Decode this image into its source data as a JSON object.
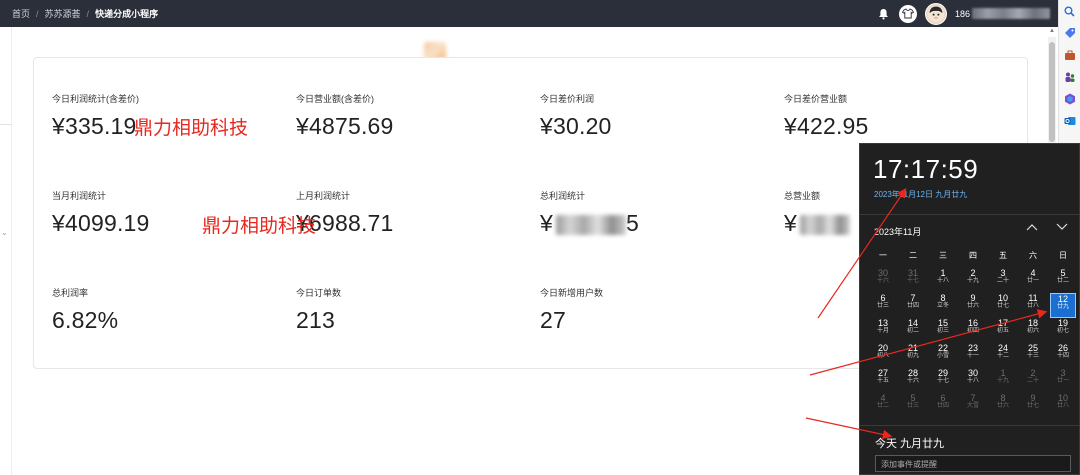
{
  "breadcrumb": [
    "首页",
    "苏苏源荟",
    "快递分成小程序"
  ],
  "breadcrumb_sep": "/",
  "header": {
    "phone_prefix": "186",
    "icons": [
      "bell-icon",
      "shirt-icon",
      "avatar"
    ]
  },
  "stats": [
    {
      "label": "今日利润统计(含差价)",
      "value": "¥335.19"
    },
    {
      "label": "今日营业额(含差价)",
      "value": "¥4875.69"
    },
    {
      "label": "今日差价利润",
      "value": "¥30.20"
    },
    {
      "label": "今日差价营业额",
      "value": "¥422.95"
    },
    {
      "label": "当月利润统计",
      "value": "¥4099.19"
    },
    {
      "label": "上月利润统计",
      "value": "¥6988.71"
    },
    {
      "label": "总利润统计",
      "value": "¥",
      "value_tail": "5"
    },
    {
      "label": "总营业额",
      "value": "¥"
    },
    {
      "label": "总利润率",
      "value": "6.82%"
    },
    {
      "label": "今日订单数",
      "value": "213"
    },
    {
      "label": "今日新增用户数",
      "value": "27"
    }
  ],
  "watermarks": [
    "鼎力相助科技",
    "鼎力相助科技"
  ],
  "calendar": {
    "time": "17:17:59",
    "date_long": "2023年11月12日 九月廿九",
    "month_label": "2023年11月",
    "weekdays": [
      "一",
      "二",
      "三",
      "四",
      "五",
      "六",
      "日"
    ],
    "days": [
      {
        "d": "30",
        "l": "十六",
        "dim": true
      },
      {
        "d": "31",
        "l": "十七",
        "dim": true
      },
      {
        "d": "1",
        "l": "十八"
      },
      {
        "d": "2",
        "l": "十九"
      },
      {
        "d": "3",
        "l": "二十"
      },
      {
        "d": "4",
        "l": "廿一"
      },
      {
        "d": "5",
        "l": "廿二"
      },
      {
        "d": "6",
        "l": "廿三"
      },
      {
        "d": "7",
        "l": "廿四"
      },
      {
        "d": "8",
        "l": "立冬"
      },
      {
        "d": "9",
        "l": "廿六"
      },
      {
        "d": "10",
        "l": "廿七"
      },
      {
        "d": "11",
        "l": "廿八"
      },
      {
        "d": "12",
        "l": "廿九",
        "today": true
      },
      {
        "d": "13",
        "l": "十月"
      },
      {
        "d": "14",
        "l": "初二"
      },
      {
        "d": "15",
        "l": "初三"
      },
      {
        "d": "16",
        "l": "初四"
      },
      {
        "d": "17",
        "l": "初五"
      },
      {
        "d": "18",
        "l": "初六"
      },
      {
        "d": "19",
        "l": "初七"
      },
      {
        "d": "20",
        "l": "初八"
      },
      {
        "d": "21",
        "l": "初九"
      },
      {
        "d": "22",
        "l": "小雪"
      },
      {
        "d": "23",
        "l": "十一"
      },
      {
        "d": "24",
        "l": "十二"
      },
      {
        "d": "25",
        "l": "十三"
      },
      {
        "d": "26",
        "l": "十四"
      },
      {
        "d": "27",
        "l": "十五"
      },
      {
        "d": "28",
        "l": "十六"
      },
      {
        "d": "29",
        "l": "十七"
      },
      {
        "d": "30",
        "l": "十八"
      },
      {
        "d": "1",
        "l": "十九",
        "dim": true
      },
      {
        "d": "2",
        "l": "二十",
        "dim": true
      },
      {
        "d": "3",
        "l": "廿一",
        "dim": true
      },
      {
        "d": "4",
        "l": "廿二",
        "dim": true
      },
      {
        "d": "5",
        "l": "廿三",
        "dim": true
      },
      {
        "d": "6",
        "l": "廿四",
        "dim": true
      },
      {
        "d": "7",
        "l": "大雪",
        "dim": true
      },
      {
        "d": "8",
        "l": "廿六",
        "dim": true
      },
      {
        "d": "9",
        "l": "廿七",
        "dim": true
      },
      {
        "d": "10",
        "l": "廿八",
        "dim": true
      }
    ],
    "today_label": "今天 九月廿九",
    "add_event_placeholder": "添加事件或提醒"
  },
  "colors": {
    "topbar": "#2b2f3a",
    "watermark": "#e8281f",
    "calendar_bg": "#202020",
    "today_cell": "#1b6fd1",
    "accent_text": "#6fb3f2"
  }
}
